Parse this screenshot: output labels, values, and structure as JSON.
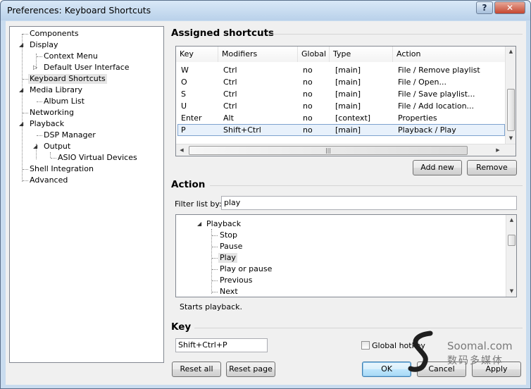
{
  "window": {
    "title": "Preferences: Keyboard Shortcuts",
    "help_label": "?",
    "close_label": "✕"
  },
  "tree": {
    "items": [
      {
        "label": "Components"
      },
      {
        "label": "Display"
      },
      {
        "label": "Context Menu"
      },
      {
        "label": "Default User Interface"
      },
      {
        "label": "Keyboard Shortcuts"
      },
      {
        "label": "Media Library"
      },
      {
        "label": "Album List"
      },
      {
        "label": "Networking"
      },
      {
        "label": "Playback"
      },
      {
        "label": "DSP Manager"
      },
      {
        "label": "Output"
      },
      {
        "label": "ASIO Virtual Devices"
      },
      {
        "label": "Shell Integration"
      },
      {
        "label": "Advanced"
      }
    ]
  },
  "assigned": {
    "heading": "Assigned shortcuts",
    "columns": [
      "Key",
      "Modifiers",
      "Global",
      "Type",
      "Action"
    ],
    "rows": [
      [
        "W",
        "Ctrl",
        "no",
        "[main]",
        "File / Remove playlist"
      ],
      [
        "O",
        "Ctrl",
        "no",
        "[main]",
        "File / Open..."
      ],
      [
        "S",
        "Ctrl",
        "no",
        "[main]",
        "File / Save playlist..."
      ],
      [
        "U",
        "Ctrl",
        "no",
        "[main]",
        "File / Add location..."
      ],
      [
        "Enter",
        "Alt",
        "no",
        "[context]",
        "Properties"
      ],
      [
        "P",
        "Shift+Ctrl",
        "no",
        "[main]",
        "Playback / Play"
      ]
    ],
    "hscroll_grip": "|||",
    "add_label": "Add new",
    "remove_label": "Remove"
  },
  "action": {
    "heading": "Action",
    "filter_label": "Filter list by:",
    "filter_value": "play",
    "items": [
      {
        "label": "Playback"
      },
      {
        "label": "Stop"
      },
      {
        "label": "Pause"
      },
      {
        "label": "Play"
      },
      {
        "label": "Play or pause"
      },
      {
        "label": "Previous"
      },
      {
        "label": "Next"
      }
    ],
    "description": "Starts playback."
  },
  "key": {
    "heading": "Key",
    "value": "Shift+Ctrl+P",
    "global_hotkey_label": "Global hotkey"
  },
  "buttons": {
    "reset_all": "Reset all",
    "reset_page": "Reset page",
    "ok": "OK",
    "cancel": "Cancel",
    "apply": "Apply"
  },
  "watermark": {
    "site": "Soomal.com",
    "cn": "数码多媒体"
  }
}
